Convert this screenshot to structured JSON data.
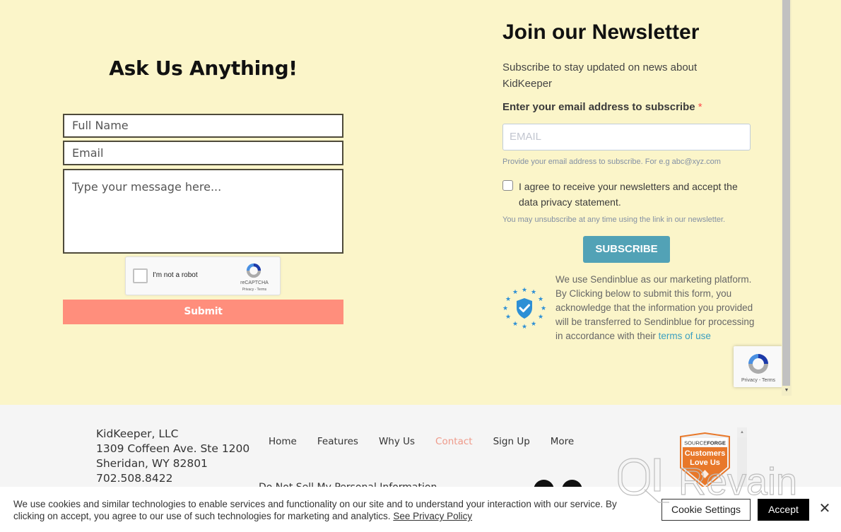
{
  "contact_form": {
    "title": "Ask Us Anything!",
    "full_name_placeholder": "Full Name",
    "email_placeholder": "Email",
    "message_placeholder": "Type your message here...",
    "recaptcha": {
      "label": "I'm not a robot",
      "brand": "reCAPTCHA",
      "links": "Privacy - Terms"
    },
    "submit_label": "Submit",
    "submit_color": "#ff8e7c"
  },
  "newsletter": {
    "title": "Join our Newsletter",
    "subtitle": "Subscribe to stay updated on news about KidKeeper",
    "email_label": "Enter your email address to subscribe",
    "required_marker": "*",
    "email_placeholder": "EMAIL",
    "email_hint": "Provide your email address to subscribe. For e.g abc@xyz.com",
    "agree_label": "I agree to receive your newsletters and accept the data privacy statement.",
    "agree_checked": false,
    "unsubscribe_note": "You may unsubscribe at any time using the link in our newsletter.",
    "subscribe_label": "SUBSCRIBE",
    "subscribe_color": "#52a2b6",
    "gdpr_text": "We use Sendinblue as our marketing platform. By Clicking below to submit this form, you acknowledge that the information you provided will be transferred to Sendinblue for processing in accordance with their",
    "gdpr_link": "terms of use",
    "recaptcha_badge_links": "Privacy - Terms"
  },
  "footer": {
    "company": "KidKeeper, LLC",
    "address_line1": "1309 Coffeen Ave. Ste 1200",
    "address_line2": "Sheridan, WY 82801",
    "phone": "702.508.8422",
    "nav": [
      {
        "label": "Home",
        "active": false
      },
      {
        "label": "Features",
        "active": false
      },
      {
        "label": "Why Us",
        "active": false
      },
      {
        "label": "Contact",
        "active": true
      },
      {
        "label": "Sign Up",
        "active": false
      },
      {
        "label": "More",
        "active": false
      }
    ],
    "do_not_sell": "Do Not Sell My Personal Information",
    "social": [
      "facebook-icon",
      "instagram-icon"
    ],
    "badge": {
      "brand_top": "SOURCE",
      "brand_bottom": "FORGE",
      "line1": "Customers",
      "line2": "Love Us"
    },
    "accent_color": "#ef9a8a"
  },
  "cookie_banner": {
    "text": "We use cookies and similar technologies to enable services and functionality on our site and to understand your interaction with our service. By clicking on accept, you agree to our use of such technologies for marketing and analytics.",
    "policy_link": "See Privacy Policy",
    "settings_label": "Cookie Settings",
    "accept_label": "Accept",
    "close_glyph": "✕"
  },
  "watermark": "Revain"
}
